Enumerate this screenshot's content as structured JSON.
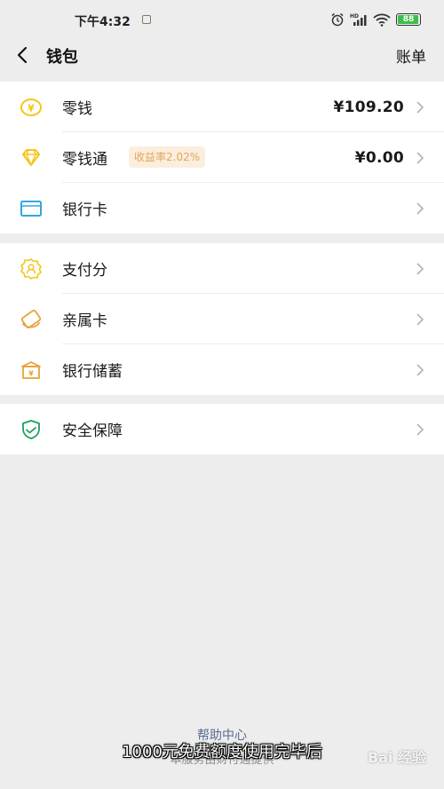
{
  "status_bar": {
    "time": "下午4:32",
    "battery": "88",
    "icons": [
      "alarm-icon",
      "hd-signal-icon",
      "wifi-icon",
      "battery-icon"
    ]
  },
  "nav": {
    "title": "钱包",
    "right_action": "账单"
  },
  "group1": {
    "items": [
      {
        "label": "零钱",
        "value": "¥109.20",
        "icon": "coin-yen-icon"
      },
      {
        "label": "零钱通",
        "badge": "收益率2.02%",
        "value": "¥0.00",
        "icon": "diamond-icon"
      },
      {
        "label": "银行卡",
        "icon": "bank-card-icon"
      }
    ]
  },
  "group2": {
    "items": [
      {
        "label": "支付分",
        "icon": "badge-person-icon"
      },
      {
        "label": "亲属卡",
        "icon": "family-card-icon"
      },
      {
        "label": "银行储蓄",
        "icon": "bank-building-icon"
      }
    ]
  },
  "group3": {
    "items": [
      {
        "label": "安全保障",
        "icon": "shield-check-icon"
      }
    ]
  },
  "footer": {
    "help_link": "帮助中心",
    "note": "本服务由财付通提供"
  },
  "overlay": {
    "caption": "1000元免费额度使用完毕后",
    "watermark": "Bai 经验"
  },
  "colors": {
    "background": "#ededed",
    "accent_yellow": "#f5c518",
    "accent_blue": "#2fa8e0",
    "accent_orange": "#e8a23a",
    "accent_green": "#19a05a",
    "link": "#576b95"
  }
}
